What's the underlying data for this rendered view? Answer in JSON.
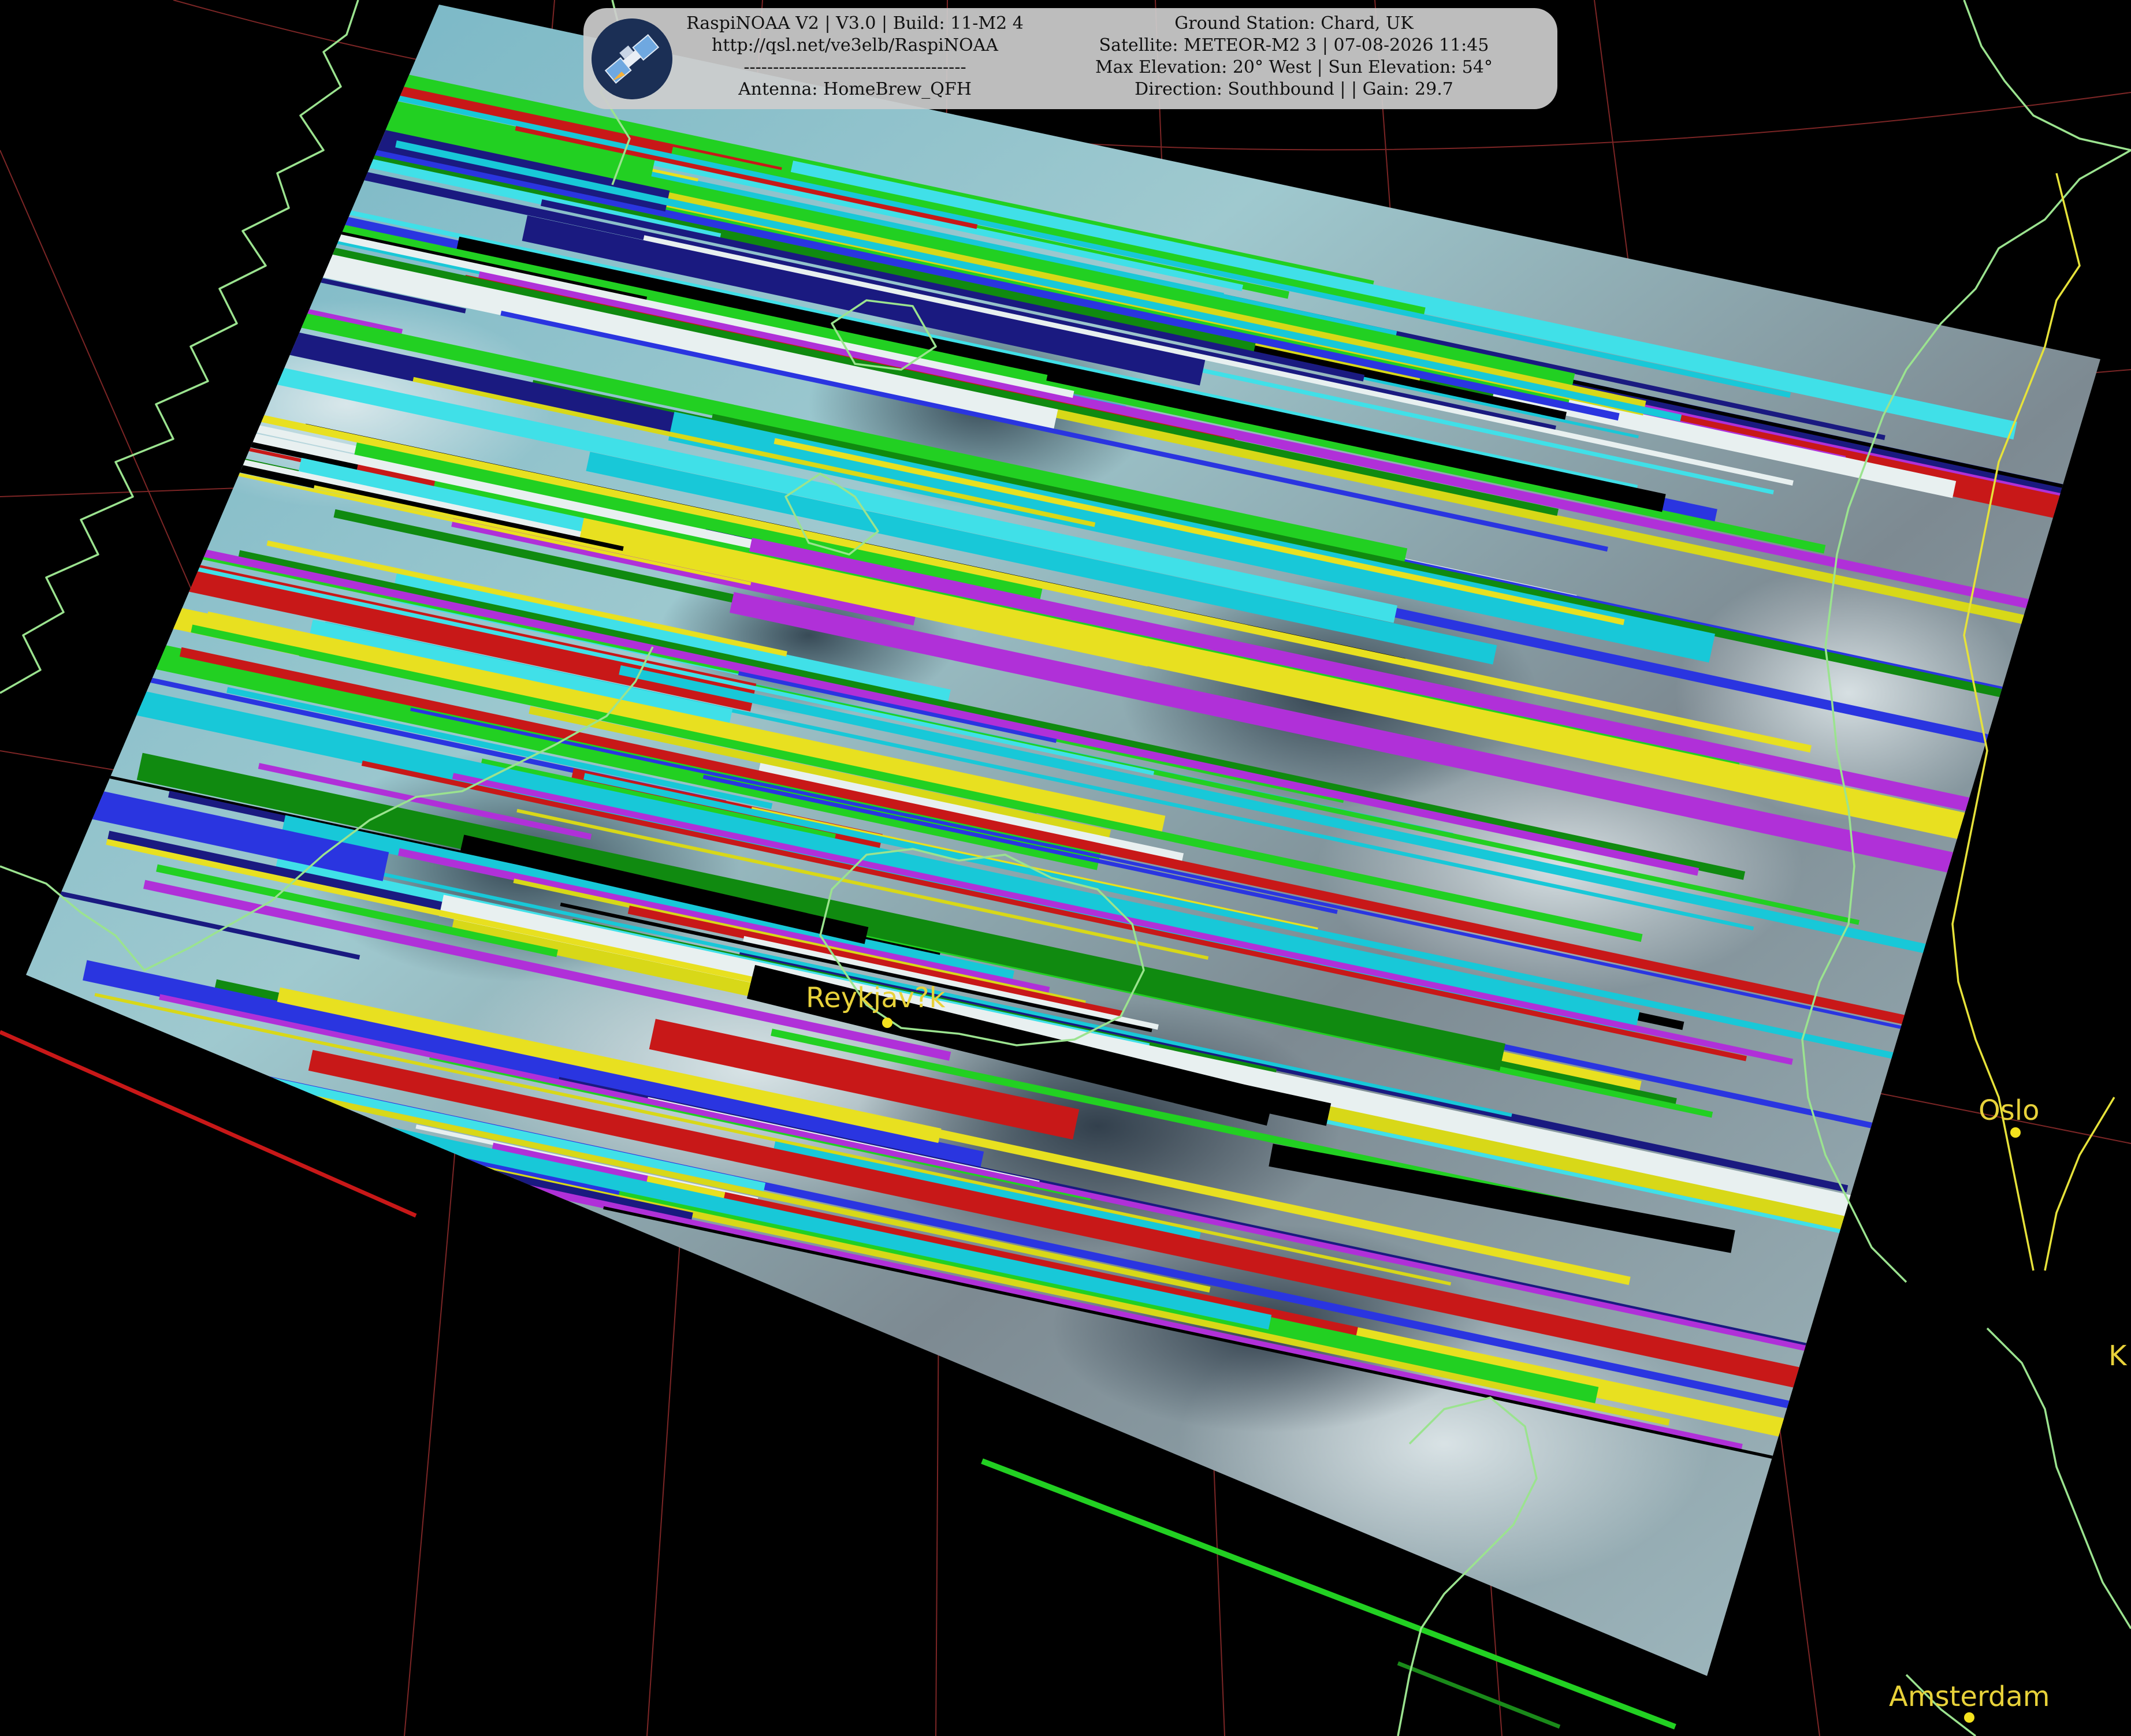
{
  "header": {
    "left_lines": [
      "RaspiNOAA V2 | V3.0 | Build: 11-M2 4",
      "http://qsl.net/ve3elb/RaspiNOAA",
      "--------------------------------------",
      "Antenna: HomeBrew_QFH"
    ],
    "right_lines": [
      "Ground Station: Chard, UK",
      "Satellite: METEOR-M2 3 | 07-08-2026 11:45",
      "Max Elevation: 20° West | Sun Elevation: 54°",
      "Direction: Southbound | | Gain: 29.7"
    ],
    "logo_icon": "satellite-icon"
  },
  "cities": [
    {
      "name": "Reykjav?k"
    },
    {
      "name": "Oslo"
    },
    {
      "name": "Amsterdam"
    },
    {
      "name": "K"
    }
  ],
  "colors": {
    "coastline": "#9be38f",
    "border": "#e6e23a",
    "graticule": "#8a2a2a",
    "city": "#f4e21e",
    "panel": "#cdcdcd"
  }
}
